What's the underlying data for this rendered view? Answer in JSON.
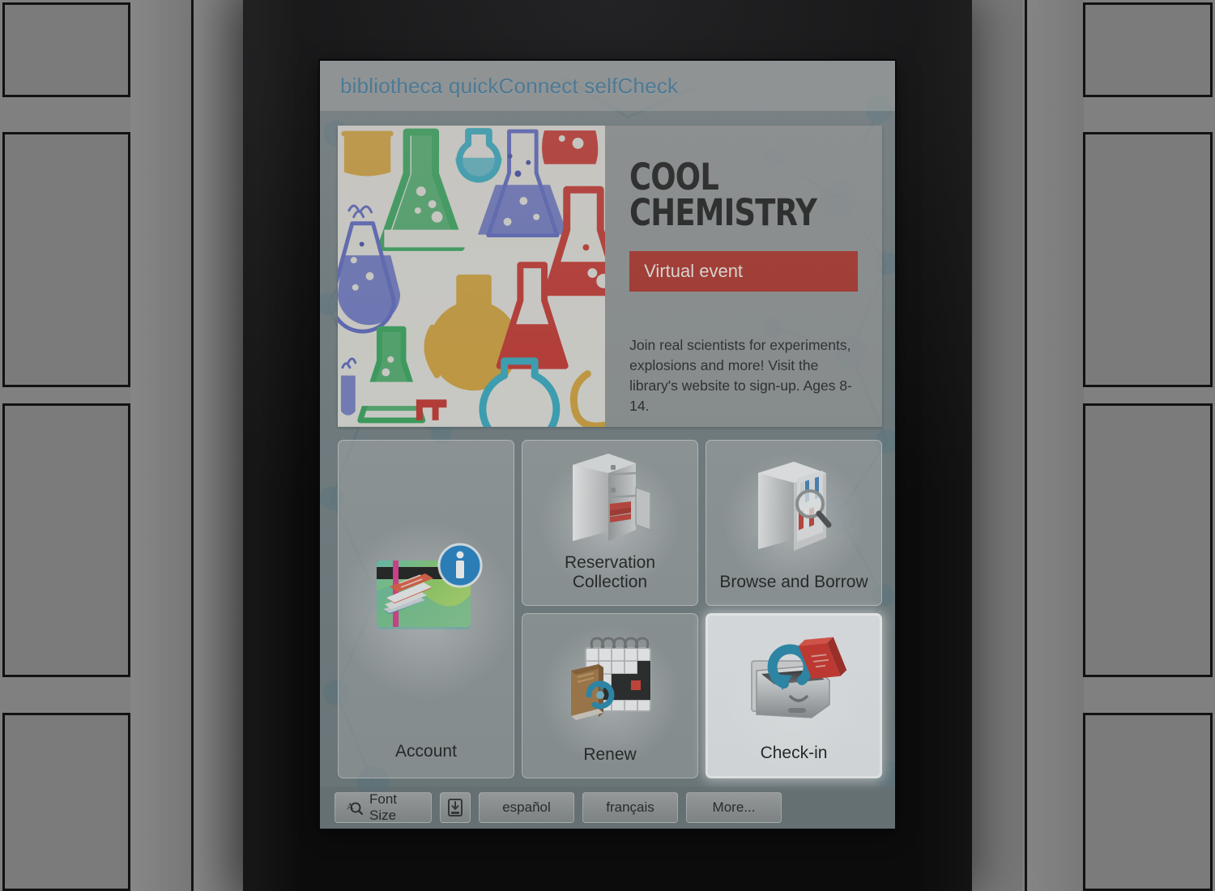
{
  "screen": {
    "app_title": "bibliotheca quickConnect selfCheck"
  },
  "promo": {
    "title": "COOL\nCHEMISTRY",
    "badge_label": "Virtual event",
    "description": "Join real scientists for experiments, explosions and more! Visit the library's website to sign-up. Ages 8-14.",
    "badge_color": "#a8281f",
    "art_name": "chemistry-flasks-pattern"
  },
  "tiles": [
    {
      "key": "account",
      "label": "Account",
      "icon": "library-card-books-info-icon",
      "selected": false
    },
    {
      "key": "reservation",
      "label": "Reservation\nCollection",
      "icon": "locker-cabinet-books-icon",
      "selected": false
    },
    {
      "key": "browse",
      "label": "Browse and Borrow",
      "icon": "bookshelf-magnifier-icon",
      "selected": false
    },
    {
      "key": "renew",
      "label": "Renew",
      "icon": "calendar-book-refresh-icon",
      "selected": false
    },
    {
      "key": "checkin",
      "label": "Check-in",
      "icon": "book-return-slot-icon",
      "selected": true
    }
  ],
  "footer": {
    "font_size_label": "Font Size",
    "font_size_icon": "magnifier-letter-icon",
    "lower_screen_icon": "lower-screen-icon",
    "lang_spanish": "español",
    "lang_french": "français",
    "more_label": "More..."
  },
  "theme": {
    "title_color": "#2f6d93",
    "screen_bg": "#6d797c",
    "tile_bg": "#a8aaaa",
    "selected_tile_border": "#ffffff",
    "kiosk_body": "#141415",
    "wall": "#7b7b7b"
  }
}
